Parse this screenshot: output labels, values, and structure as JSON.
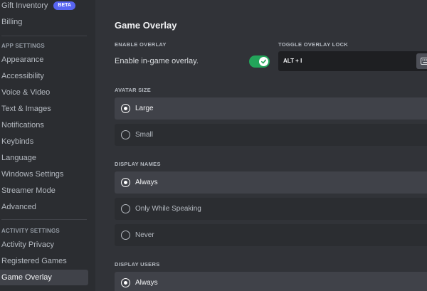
{
  "sidebar": {
    "items_top": [
      {
        "label": "Gift Inventory",
        "badge": "BETA"
      },
      {
        "label": "Billing"
      }
    ],
    "app_settings_header": "APP SETTINGS",
    "app_settings": [
      {
        "label": "Appearance"
      },
      {
        "label": "Accessibility"
      },
      {
        "label": "Voice & Video"
      },
      {
        "label": "Text & Images"
      },
      {
        "label": "Notifications"
      },
      {
        "label": "Keybinds"
      },
      {
        "label": "Language"
      },
      {
        "label": "Windows Settings"
      },
      {
        "label": "Streamer Mode"
      },
      {
        "label": "Advanced"
      }
    ],
    "activity_settings_header": "ACTIVITY SETTINGS",
    "activity_settings": [
      {
        "label": "Activity Privacy"
      },
      {
        "label": "Registered Games"
      },
      {
        "label": "Game Overlay",
        "selected": true
      }
    ]
  },
  "main": {
    "title": "Game Overlay",
    "enable_overlay": {
      "label": "ENABLE OVERLAY",
      "text": "Enable in-game overlay.",
      "enabled": true,
      "toggle_color": "#23a55a"
    },
    "toggle_lock": {
      "label": "TOGGLE OVERLAY LOCK",
      "value": "ALT + I",
      "icon": "keyboard-icon"
    },
    "avatar_size": {
      "label": "AVATAR SIZE",
      "options": [
        {
          "label": "Large",
          "selected": true
        },
        {
          "label": "Small",
          "selected": false
        }
      ]
    },
    "display_names": {
      "label": "DISPLAY NAMES",
      "options": [
        {
          "label": "Always",
          "selected": true
        },
        {
          "label": "Only While Speaking",
          "selected": false
        },
        {
          "label": "Never",
          "selected": false
        }
      ]
    },
    "display_users": {
      "label": "DISPLAY USERS",
      "options": [
        {
          "label": "Always",
          "selected": true
        }
      ]
    }
  },
  "colors": {
    "background": "#313338",
    "sidebar": "#2b2d31",
    "accent": "#5865f2"
  }
}
